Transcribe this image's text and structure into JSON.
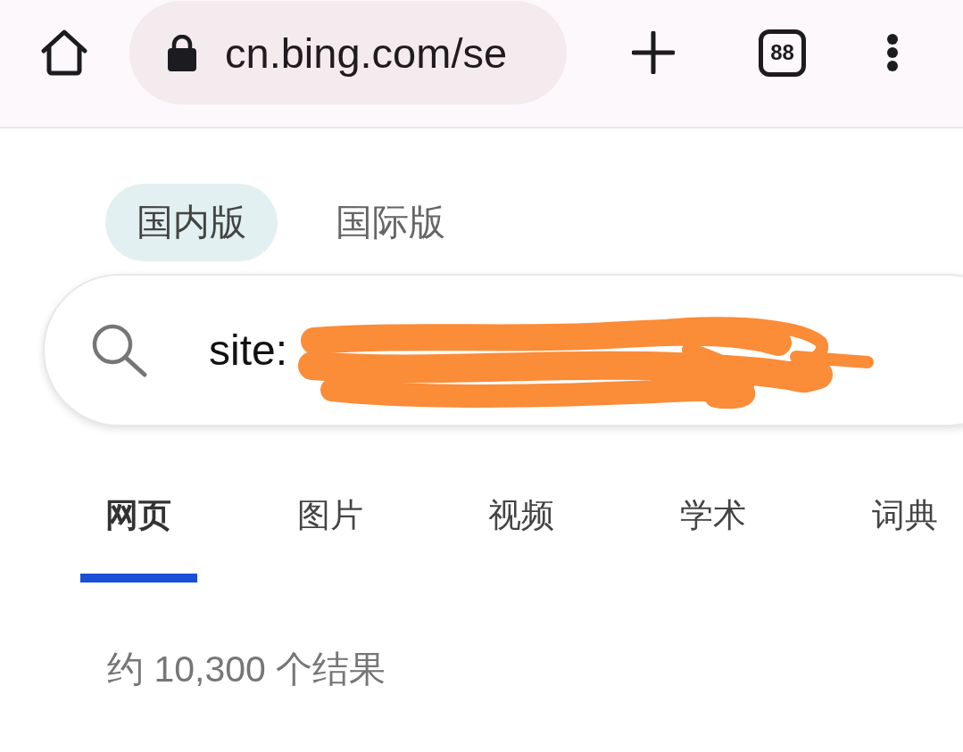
{
  "browser_bar": {
    "url": "cn.bing.com/se",
    "tab_count": "88"
  },
  "edition_tabs": [
    {
      "label": "国内版",
      "selected": true
    },
    {
      "label": "国际版",
      "selected": false
    }
  ],
  "search": {
    "value": "site:",
    "redacted": true
  },
  "nav_tabs": [
    {
      "label": "网页",
      "selected": true
    },
    {
      "label": "图片",
      "selected": false
    },
    {
      "label": "视频",
      "selected": false
    },
    {
      "label": "学术",
      "selected": false
    },
    {
      "label": "词典",
      "selected": false
    }
  ],
  "result_count": "约 10,300 个结果"
}
